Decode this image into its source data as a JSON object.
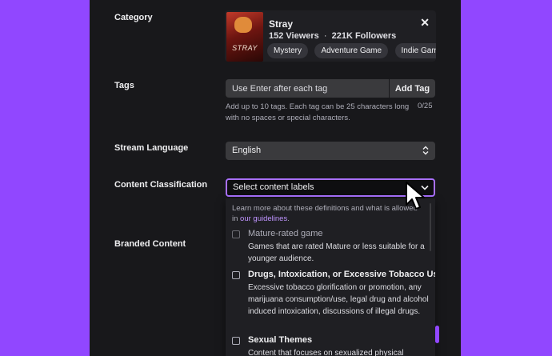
{
  "labels": {
    "category": "Category",
    "tags": "Tags",
    "stream_language": "Stream Language",
    "content_classification": "Content Classification",
    "branded_content": "Branded Content"
  },
  "category": {
    "name": "Stray",
    "viewers": "152 Viewers",
    "separator": "·",
    "followers": "221K Followers",
    "art_logo": "STRAY",
    "close_glyph": "✕",
    "tags": [
      "Mystery",
      "Adventure Game",
      "Indie Game"
    ]
  },
  "tags": {
    "placeholder": "Use Enter after each tag",
    "add_label": "Add Tag",
    "help": "Add up to 10 tags. Each tag can be 25 characters long with no spaces or special characters.",
    "count": "0/25"
  },
  "language": {
    "value": "English",
    "icon": "updown-chevron-icon"
  },
  "content_classification": {
    "placeholder": "Select content labels",
    "icon": "chevron-down-icon",
    "intro_text": "Learn more about these definitions and what is allowed in ",
    "intro_link": "our guidelines",
    "intro_end": ".",
    "options": [
      {
        "title": "Mature-rated game",
        "desc": "Games that are rated Mature or less suitable for a younger audience."
      },
      {
        "title": "Drugs, Intoxication, or Excessive Tobacco Use",
        "desc": "Excessive tobacco glorification or promotion, any marijuana consumption/use, legal drug and alcohol induced intoxication, discussions of illegal drugs."
      },
      {
        "title": "Sexual Themes",
        "desc": "Content that focuses on sexualized physical attributes and activities"
      }
    ]
  },
  "colors": {
    "background": "#9147ff",
    "panel": "#18181b",
    "accent": "#a970ff",
    "link": "#bf94ff"
  }
}
